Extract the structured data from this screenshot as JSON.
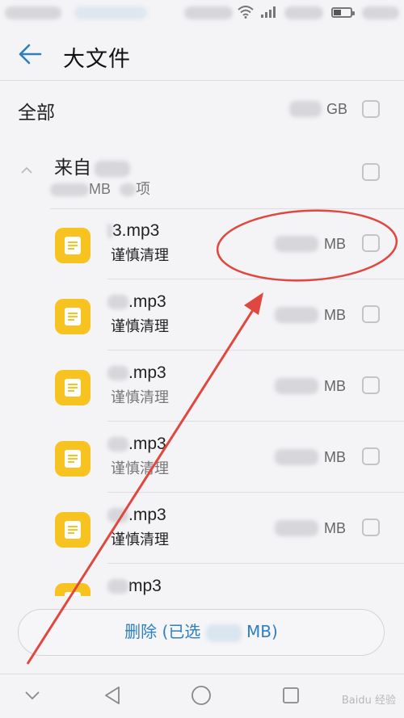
{
  "header": {
    "title": "大文件"
  },
  "all_row": {
    "label": "全部",
    "size_unit": "GB"
  },
  "group": {
    "source_prefix": "来自",
    "size_unit": "MB",
    "count_suffix": "项"
  },
  "files": [
    {
      "name_suffix": "3.mp3",
      "hint": "谨慎清理",
      "size_unit": "MB"
    },
    {
      "name_suffix": ".mp3",
      "hint": "谨慎清理",
      "size_unit": "MB"
    },
    {
      "name_suffix": ".mp3",
      "hint": "谨慎清理",
      "size_unit": "MB"
    },
    {
      "name_suffix": ".mp3",
      "hint": "谨慎清理",
      "size_unit": "MB"
    },
    {
      "name_suffix": ".mp3",
      "hint": "谨慎清理",
      "size_unit": "MB"
    },
    {
      "name_suffix": "mp3",
      "hint": "",
      "size_unit": ""
    }
  ],
  "delete_button": {
    "prefix": "删除 (已选",
    "suffix": "MB)"
  },
  "watermark": "Baidu 经验",
  "colors": {
    "accent": "#2d7fc1",
    "file_icon": "#f7c321",
    "annotation": "#e0473f"
  },
  "icons": {
    "back": "arrow-left-icon",
    "collapse": "chevron-up-icon",
    "file": "document-icon",
    "nav_down": "chevron-down-icon",
    "nav_back": "triangle-back-icon",
    "nav_home": "circle-home-icon",
    "nav_recent": "square-recents-icon"
  }
}
